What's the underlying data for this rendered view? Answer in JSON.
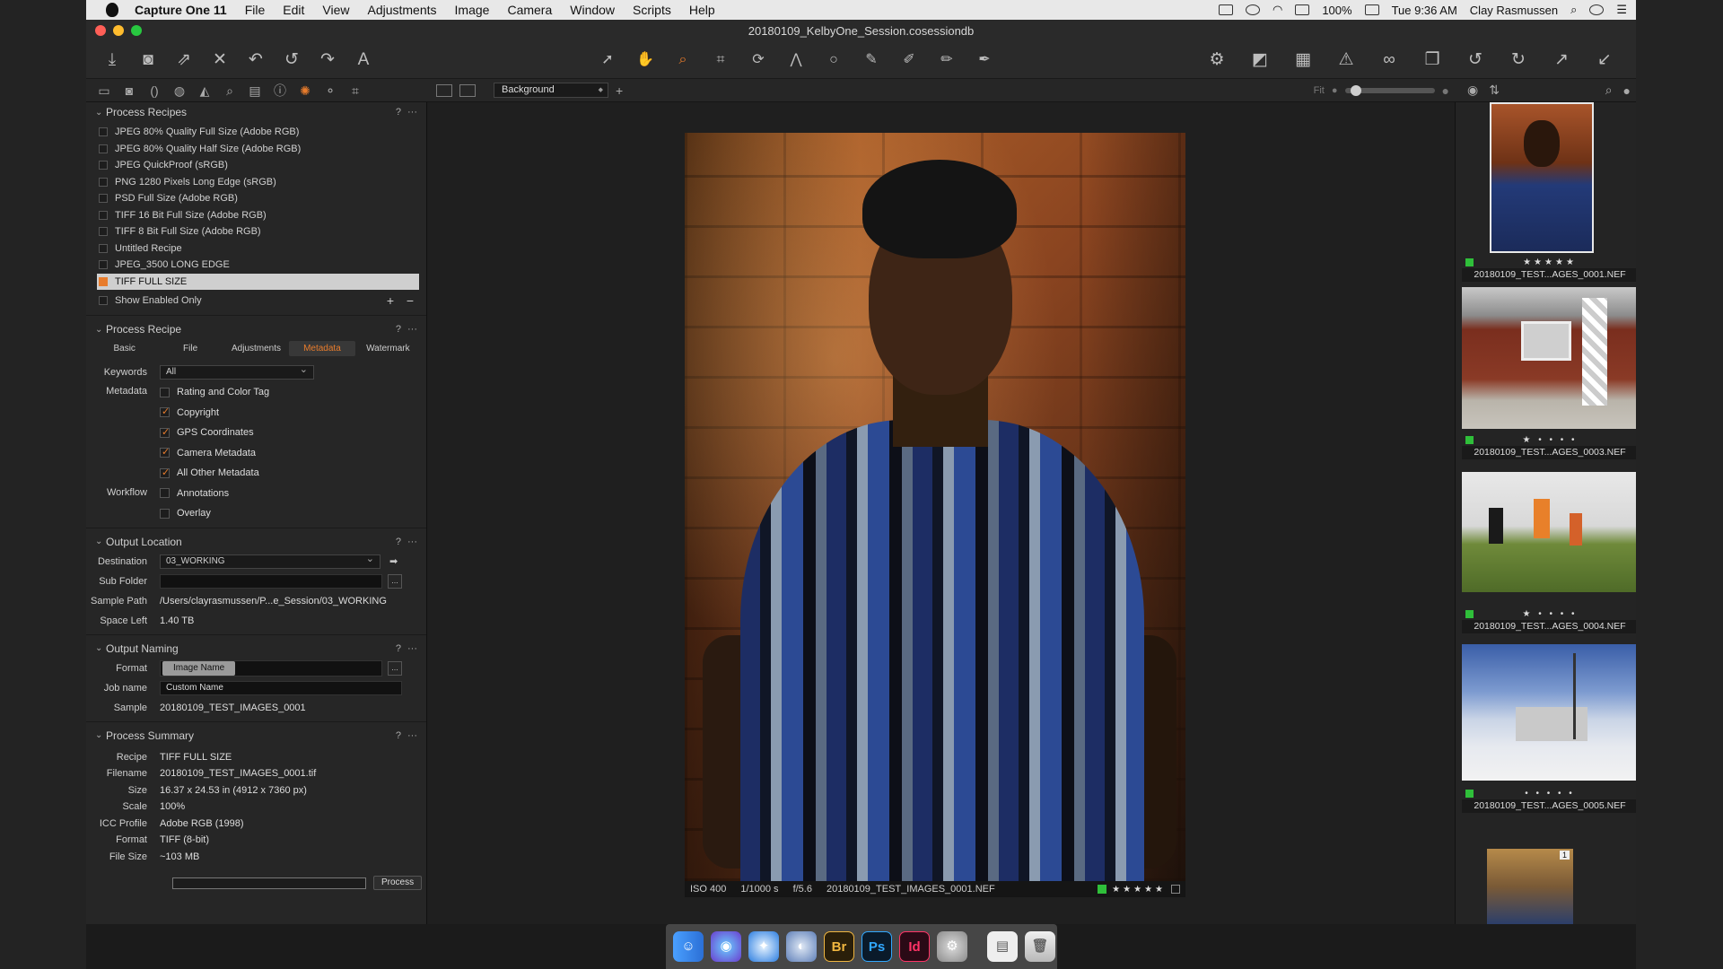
{
  "menubar": {
    "app_name": "Capture One 11",
    "menus": [
      "File",
      "Edit",
      "View",
      "Adjustments",
      "Image",
      "Camera",
      "Window",
      "Scripts",
      "Help"
    ],
    "battery": "100%",
    "time": "Tue 9:36 AM",
    "user": "Clay Rasmussen"
  },
  "window": {
    "title": "20180109_KelbyOne_Session.cosessiondb"
  },
  "viewer_toolbar": {
    "style_select": "Background",
    "fit_label": "Fit",
    "zoom_level": 0.1
  },
  "process_recipes": {
    "title": "Process Recipes",
    "items": [
      {
        "label": "JPEG 80% Quality Full Size (Adobe RGB)",
        "selected": false
      },
      {
        "label": "JPEG 80% Quality Half Size (Adobe RGB)",
        "selected": false
      },
      {
        "label": "JPEG QuickProof (sRGB)",
        "selected": false
      },
      {
        "label": "PNG 1280 Pixels Long Edge (sRGB)",
        "selected": false
      },
      {
        "label": "PSD Full Size (Adobe RGB)",
        "selected": false
      },
      {
        "label": "TIFF 16 Bit Full Size (Adobe RGB)",
        "selected": false
      },
      {
        "label": "TIFF 8 Bit Full Size (Adobe RGB)",
        "selected": false
      },
      {
        "label": "Untitled Recipe",
        "selected": false
      },
      {
        "label": "JPEG_3500 LONG EDGE",
        "selected": false
      },
      {
        "label": "TIFF FULL SIZE",
        "selected": true
      }
    ],
    "show_enabled_only": "Show Enabled Only"
  },
  "process_recipe": {
    "title": "Process Recipe",
    "tabs": [
      "Basic",
      "File",
      "Adjustments",
      "Metadata",
      "Watermark"
    ],
    "active_tab": "Metadata",
    "keywords_label": "Keywords",
    "keywords_value": "All",
    "metadata_label": "Metadata",
    "metadata_options": [
      {
        "label": "Rating and Color Tag",
        "checked": false
      },
      {
        "label": "Copyright",
        "checked": true
      },
      {
        "label": "GPS Coordinates",
        "checked": true
      },
      {
        "label": "Camera Metadata",
        "checked": true
      },
      {
        "label": "All Other Metadata",
        "checked": true
      }
    ],
    "workflow_label": "Workflow",
    "workflow_options": [
      {
        "label": "Annotations",
        "checked": false
      },
      {
        "label": "Overlay",
        "checked": false
      }
    ]
  },
  "output_location": {
    "title": "Output Location",
    "destination_label": "Destination",
    "destination_value": "03_WORKING",
    "sub_folder_label": "Sub Folder",
    "sub_folder_value": "",
    "sample_path_label": "Sample Path",
    "sample_path_value": "/Users/clayrasmussen/P...e_Session/03_WORKING",
    "space_left_label": "Space Left",
    "space_left_value": "1.40 TB"
  },
  "output_naming": {
    "title": "Output Naming",
    "format_label": "Format",
    "format_token": "Image Name",
    "job_name_label": "Job name",
    "job_name_value": "Custom Name",
    "sample_label": "Sample",
    "sample_value": "20180109_TEST_IMAGES_0001"
  },
  "process_summary": {
    "title": "Process Summary",
    "rows": [
      {
        "label": "Recipe",
        "value": "TIFF FULL SIZE"
      },
      {
        "label": "Filename",
        "value": "20180109_TEST_IMAGES_0001.tif"
      },
      {
        "label": "Size",
        "value": "16.37 x 24.53 in (4912 x 7360 px)"
      },
      {
        "label": "Scale",
        "value": "100%"
      },
      {
        "label": "ICC Profile",
        "value": "Adobe RGB (1998)"
      },
      {
        "label": "Format",
        "value": "TIFF (8-bit)"
      },
      {
        "label": "File Size",
        "value": "~103 MB"
      }
    ],
    "process_button": "Process"
  },
  "viewer_info": {
    "iso": "ISO 400",
    "shutter": "1/1000 s",
    "aperture": "f/5.6",
    "filename": "20180109_TEST_IMAGES_0001.NEF",
    "color_tag": "#2fbf3a",
    "rating": 5
  },
  "browser": {
    "thumbnails": [
      {
        "name": "20180109_TEST...AGES_0001.NEF",
        "rating": 5,
        "color_tag": "#2fbf3a",
        "selected": true
      },
      {
        "name": "20180109_TEST...AGES_0003.NEF",
        "rating": 1,
        "color_tag": "#2fbf3a",
        "selected": false
      },
      {
        "name": "20180109_TEST...AGES_0004.NEF",
        "rating": 1,
        "color_tag": "#2fbf3a",
        "selected": false
      },
      {
        "name": "20180109_TEST...AGES_0005.NEF",
        "rating": 0,
        "color_tag": "#2fbf3a",
        "selected": false
      }
    ],
    "last_thumb_badge": "1"
  },
  "dock": {
    "apps": [
      "Finder",
      "Siri",
      "Safari",
      "Capture One",
      "Bridge",
      "Photoshop",
      "InDesign",
      "System Preferences",
      "Documents",
      "Trash"
    ],
    "labels": {
      "bridge": "Br",
      "photoshop": "Ps",
      "indesign": "Id"
    }
  },
  "colors": {
    "accent": "#e87c2c",
    "panel_bg": "#262626",
    "viewer_bg": "#1f1f1f"
  }
}
